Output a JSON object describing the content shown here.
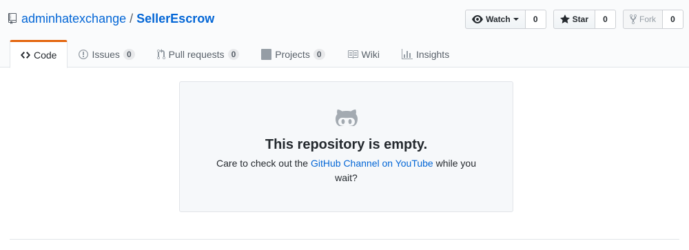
{
  "repo": {
    "owner": "adminhatexchange",
    "separator": "/",
    "name": "SellerEscrow"
  },
  "actions": {
    "watch": {
      "label": "Watch",
      "count": "0"
    },
    "star": {
      "label": "Star",
      "count": "0"
    },
    "fork": {
      "label": "Fork",
      "count": "0"
    }
  },
  "tabs": [
    {
      "label": "Code",
      "icon": "code-icon",
      "selected": true
    },
    {
      "label": "Issues",
      "icon": "issue-icon",
      "count": "0"
    },
    {
      "label": "Pull requests",
      "icon": "pull-request-icon",
      "count": "0"
    },
    {
      "label": "Projects",
      "icon": "project-icon",
      "count": "0"
    },
    {
      "label": "Wiki",
      "icon": "book-icon"
    },
    {
      "label": "Insights",
      "icon": "graph-icon"
    }
  ],
  "blankslate": {
    "icon": "octoface-icon",
    "title": "This repository is empty.",
    "text_before": "Care to check out the ",
    "link": "GitHub Channel on YouTube",
    "text_after": " while you wait?"
  },
  "colors": {
    "link": "#0366d6",
    "selected_tab_accent": "#e36209"
  }
}
